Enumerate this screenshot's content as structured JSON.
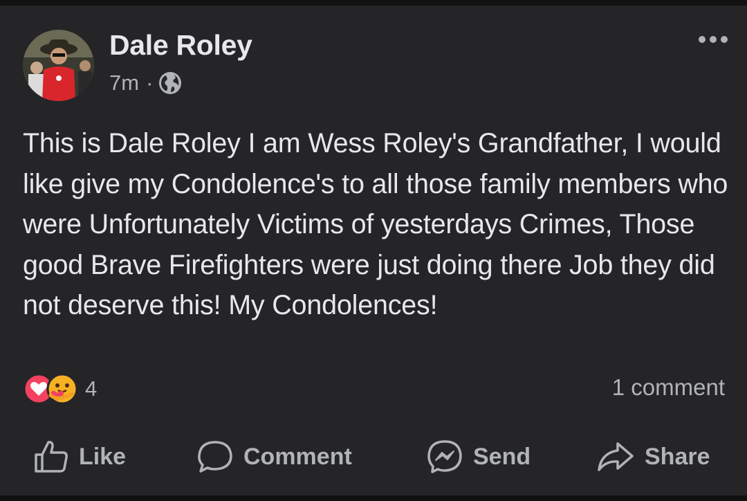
{
  "post": {
    "author": "Dale Roley",
    "time": "7m",
    "separator": "·",
    "privacy_icon": "globe-icon",
    "more_icon": "more-options-icon",
    "text": "This is Dale Roley I am Wess Roley's Grandfather, I would like give my Condolence's to all those family members who were Unfortunately Victims of yesterdays Crimes, Those good Brave Firefighters were just doing there Job they did not deserve this! My Condolences!",
    "reactions": {
      "icons": [
        "love-reaction-icon",
        "care-reaction-icon"
      ],
      "count": "4"
    },
    "comments_count": "1 comment"
  },
  "actions": {
    "like": "Like",
    "comment": "Comment",
    "send": "Send",
    "share": "Share"
  },
  "colors": {
    "background": "#252527",
    "text_primary": "#e7e8ec",
    "text_secondary": "#b0b3b8",
    "love_red": "#f3425f",
    "care_yellow": "#f7b125"
  }
}
